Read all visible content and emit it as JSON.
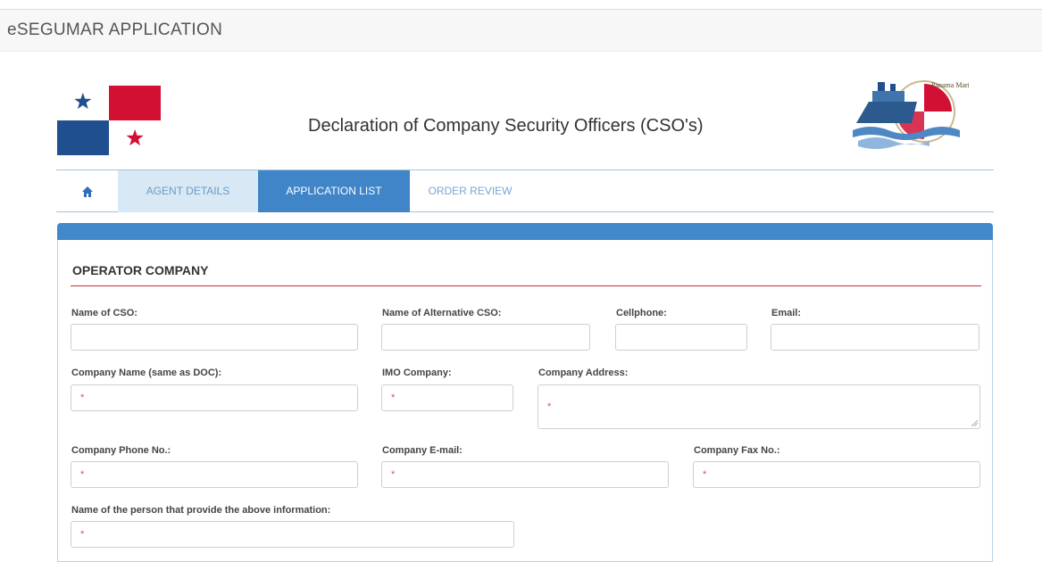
{
  "app": {
    "title": "eSEGUMAR APPLICATION"
  },
  "header": {
    "title": "Declaration of Company Security Officers (CSO's)",
    "logo_text": "Panama Maritime Authority"
  },
  "tabs": [
    {
      "label": "AGENT DETAILS"
    },
    {
      "label": "APPLICATION LIST",
      "active": true
    },
    {
      "label": "ORDER REVIEW"
    }
  ],
  "icons": {
    "home": "home-icon"
  },
  "colors": {
    "accent": "#3f85c8",
    "required": "#d9534f",
    "section_rule": "#c9302c",
    "tab_light": "#d9e8f5"
  },
  "section": {
    "title": "OPERATOR COMPANY"
  },
  "fields": {
    "name_cso": {
      "label": "Name of CSO:"
    },
    "name_alt_cso": {
      "label": "Name of Alternative CSO:"
    },
    "cellphone": {
      "label": "Cellphone:"
    },
    "email": {
      "label": "Email:"
    },
    "company_name": {
      "label": "Company Name (same as DOC):",
      "marker": "*"
    },
    "imo_company": {
      "label": "IMO Company:",
      "marker": "*"
    },
    "company_address": {
      "label": "Company Address:",
      "marker": "*"
    },
    "company_phone": {
      "label": "Company Phone No.:",
      "marker": "*"
    },
    "company_email": {
      "label": "Company E-mail:",
      "marker": "*"
    },
    "company_fax": {
      "label": "Company Fax No.:",
      "marker": "*"
    },
    "provider_name": {
      "label": "Name of the person that provide the above information:",
      "marker": "*"
    }
  }
}
